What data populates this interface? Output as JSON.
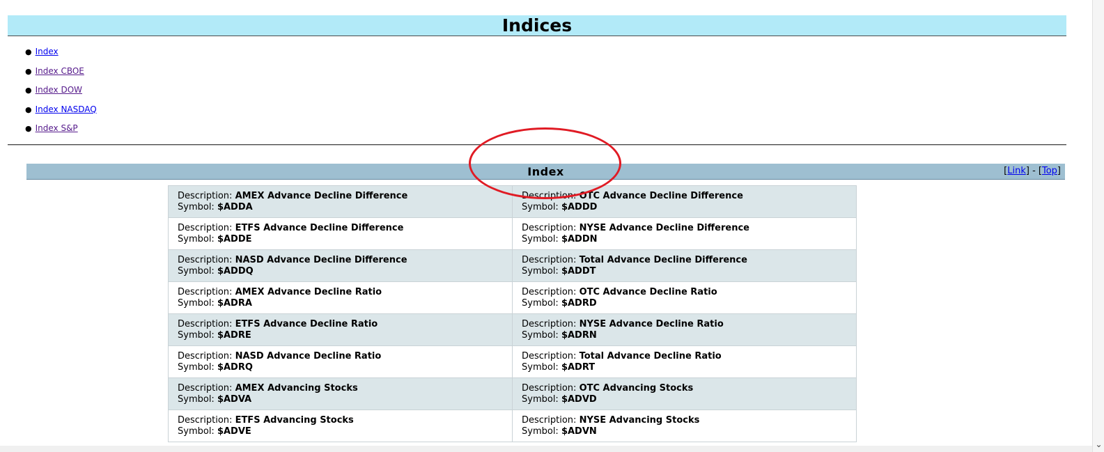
{
  "header": {
    "title": "Indices"
  },
  "nav": [
    {
      "label": "Index"
    },
    {
      "label": "Index CBOE"
    },
    {
      "label": "Index DOW"
    },
    {
      "label": "Index NASDAQ"
    },
    {
      "label": "Index S&P"
    }
  ],
  "section": {
    "title": "Index",
    "link_label": "Link",
    "top_label": "Top",
    "separator": " - "
  },
  "labels": {
    "description": "Description:",
    "symbol": "Symbol:"
  },
  "rows": [
    [
      {
        "description": "AMEX Advance Decline Difference",
        "symbol": "$ADDA"
      },
      {
        "description": "OTC Advance Decline Difference",
        "symbol": "$ADDD"
      }
    ],
    [
      {
        "description": "ETFS Advance Decline Difference",
        "symbol": "$ADDE"
      },
      {
        "description": "NYSE Advance Decline Difference",
        "symbol": "$ADDN"
      }
    ],
    [
      {
        "description": "NASD Advance Decline Difference",
        "symbol": "$ADDQ"
      },
      {
        "description": "Total Advance Decline Difference",
        "symbol": "$ADDT"
      }
    ],
    [
      {
        "description": "AMEX Advance Decline Ratio",
        "symbol": "$ADRA"
      },
      {
        "description": "OTC Advance Decline Ratio",
        "symbol": "$ADRD"
      }
    ],
    [
      {
        "description": "ETFS Advance Decline Ratio",
        "symbol": "$ADRE"
      },
      {
        "description": "NYSE Advance Decline Ratio",
        "symbol": "$ADRN"
      }
    ],
    [
      {
        "description": "NASD Advance Decline Ratio",
        "symbol": "$ADRQ"
      },
      {
        "description": "Total Advance Decline Ratio",
        "symbol": "$ADRT"
      }
    ],
    [
      {
        "description": "AMEX Advancing Stocks",
        "symbol": "$ADVA"
      },
      {
        "description": "OTC Advancing Stocks",
        "symbol": "$ADVD"
      }
    ],
    [
      {
        "description": "ETFS Advancing Stocks",
        "symbol": "$ADVE"
      },
      {
        "description": "NYSE Advancing Stocks",
        "symbol": "$ADVN"
      }
    ]
  ],
  "colors": {
    "header_bg": "#b2eaf8",
    "section_bg": "#9ebfd1",
    "row_odd": "#dbe6e9",
    "row_even": "#ffffff",
    "annotation": "#e01b24",
    "link": "#0000ee",
    "visited_link": "#551a8b"
  },
  "icons": {
    "scroll_down": "chevron-down-icon"
  }
}
